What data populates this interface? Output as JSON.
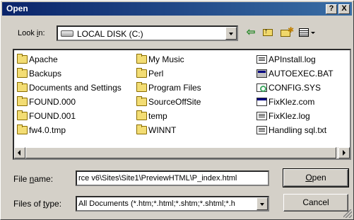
{
  "window": {
    "title": "Open",
    "help_label": "?",
    "close_label": "X"
  },
  "lookin": {
    "label_pre": "Look ",
    "label_key": "i",
    "label_post": "n:",
    "value": "LOCAL DISK (C:)"
  },
  "toolbar": {
    "back_glyph": "⇦",
    "up_glyph": "↑",
    "new_glyph": "✱"
  },
  "files": {
    "col1": [
      {
        "name": "Apache",
        "type": "folder"
      },
      {
        "name": "Backups",
        "type": "folder"
      },
      {
        "name": "Documents and Settings",
        "type": "folder"
      },
      {
        "name": "FOUND.000",
        "type": "folder"
      },
      {
        "name": "FOUND.001",
        "type": "folder"
      },
      {
        "name": "fw4.0.tmp",
        "type": "folder"
      }
    ],
    "col2": [
      {
        "name": "My Music",
        "type": "folder"
      },
      {
        "name": "Perl",
        "type": "folder"
      },
      {
        "name": "Program Files",
        "type": "folder"
      },
      {
        "name": "SourceOffSite",
        "type": "folder"
      },
      {
        "name": "temp",
        "type": "folder"
      },
      {
        "name": "WINNT",
        "type": "folder"
      }
    ],
    "col3": [
      {
        "name": "APInstall.log",
        "type": "doc"
      },
      {
        "name": "AUTOEXEC.BAT",
        "type": "bat"
      },
      {
        "name": "CONFIG.SYS",
        "type": "sys"
      },
      {
        "name": "FixKlez.com",
        "type": "com"
      },
      {
        "name": "FixKlez.log",
        "type": "doc"
      },
      {
        "name": "Handling sql.txt",
        "type": "doc"
      }
    ]
  },
  "filename": {
    "label_pre": "File ",
    "label_key": "n",
    "label_post": "ame:",
    "value": "rce v6\\Sites\\Site1\\PreviewHTML\\P_index.html"
  },
  "filetype": {
    "label_pre": "Files of ",
    "label_key": "t",
    "label_post": "ype:",
    "value": "All Documents (*.htm;*.html;*.shtm;*.shtml;*.h"
  },
  "buttons": {
    "open_key": "O",
    "open_rest": "pen",
    "cancel": "Cancel"
  }
}
